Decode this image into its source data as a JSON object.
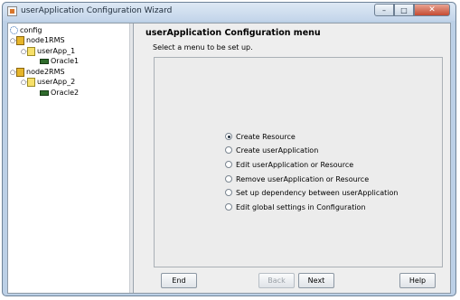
{
  "window": {
    "title": "userApplication Configuration Wizard"
  },
  "tree": {
    "items": [
      {
        "label": "config",
        "icon": "config-icon",
        "toggle": ""
      },
      {
        "label": "node1RMS",
        "icon": "node-icon",
        "toggle": "○-"
      },
      {
        "label": "userApp_1",
        "icon": "userapp-icon",
        "toggle": "○-"
      },
      {
        "label": "Oracle1",
        "icon": "resource-icon",
        "toggle": ""
      },
      {
        "label": "node2RMS",
        "icon": "node-icon",
        "toggle": "○-"
      },
      {
        "label": "userApp_2",
        "icon": "userapp-icon",
        "toggle": "○-"
      },
      {
        "label": "Oracle2",
        "icon": "resource-icon",
        "toggle": ""
      }
    ]
  },
  "main": {
    "title": "userApplication Configuration menu",
    "subtitle": "Select a menu to be set up.",
    "options": [
      {
        "label": "Create Resource",
        "selected": true
      },
      {
        "label": "Create userApplication",
        "selected": false
      },
      {
        "label": "Edit userApplication or Resource",
        "selected": false
      },
      {
        "label": "Remove userApplication or Resource",
        "selected": false
      },
      {
        "label": "Set up dependency between userApplication",
        "selected": false
      },
      {
        "label": "Edit global settings in Configuration",
        "selected": false
      }
    ]
  },
  "buttons": {
    "end": "End",
    "back": "Back",
    "next": "Next",
    "help": "Help"
  },
  "window_controls": {
    "minimize": "–",
    "maximize": "□",
    "close": "✕"
  }
}
